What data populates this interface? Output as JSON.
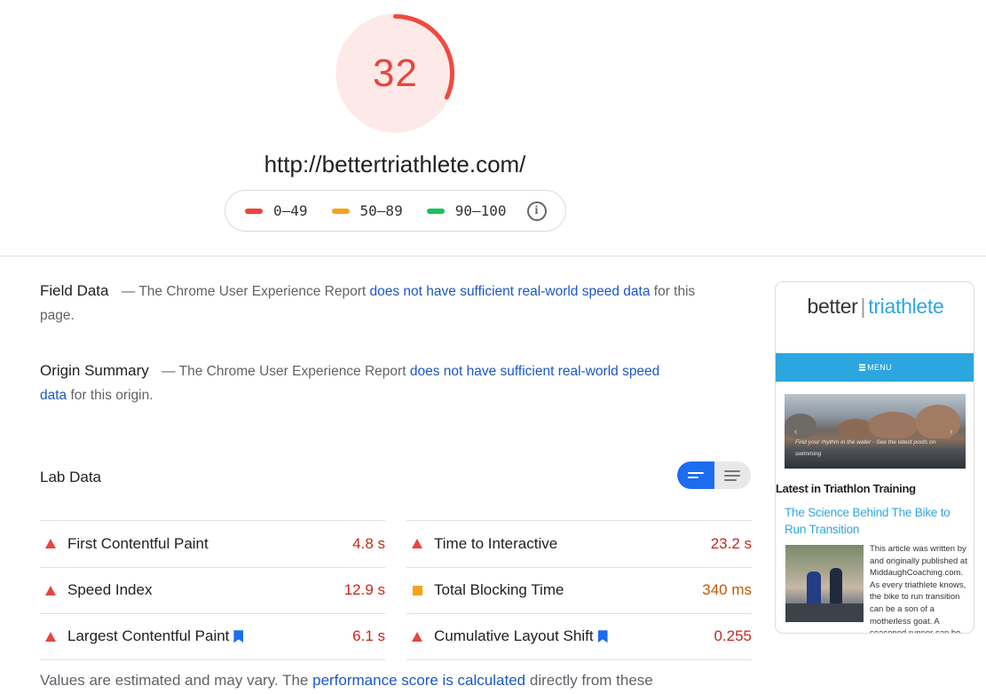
{
  "score": {
    "value": "32",
    "fraction": 0.32,
    "color": "#e8453c"
  },
  "url": "http://bettertriathlete.com/",
  "legend": {
    "items": [
      {
        "label": "0–49",
        "color": "#e8453c"
      },
      {
        "label": "50–89",
        "color": "#f6a21b"
      },
      {
        "label": "90–100",
        "color": "#19c262"
      }
    ],
    "info_icon": "info-icon"
  },
  "field_data": {
    "label": "Field Data",
    "prefix": "— The Chrome User Experience Report",
    "link": "does not have sufficient real-world speed data",
    "suffix": "for this page."
  },
  "origin_summary": {
    "label": "Origin Summary",
    "prefix": "— The Chrome User Experience Report",
    "link": "does not have sufficient real-world speed data",
    "suffix": "for this origin."
  },
  "lab_data": {
    "title": "Lab Data",
    "view_toggle": {
      "selected": "summary-view",
      "other": "detail-view"
    },
    "metrics_left": [
      {
        "name": "First Contentful Paint",
        "value": "4.8 s",
        "status": "fail",
        "icon": "red-triangle-icon",
        "bookmark": false
      },
      {
        "name": "Speed Index",
        "value": "12.9 s",
        "status": "fail",
        "icon": "red-triangle-icon",
        "bookmark": false
      },
      {
        "name": "Largest Contentful Paint",
        "value": "6.1 s",
        "status": "fail",
        "icon": "red-triangle-icon",
        "bookmark": true
      }
    ],
    "metrics_right": [
      {
        "name": "Time to Interactive",
        "value": "23.2 s",
        "status": "fail",
        "icon": "red-triangle-icon",
        "bookmark": false
      },
      {
        "name": "Total Blocking Time",
        "value": "340 ms",
        "status": "average",
        "icon": "orange-square-icon",
        "bookmark": false
      },
      {
        "name": "Cumulative Layout Shift",
        "value": "0.255",
        "status": "fail",
        "icon": "red-triangle-icon",
        "bookmark": true
      }
    ]
  },
  "footnote": {
    "prefix": "Values are estimated and may vary. The",
    "link": "performance score is calculated",
    "suffix": "directly from these"
  },
  "phone": {
    "logo_left": "better",
    "logo_right": "triathlete",
    "menu_label": "MENU",
    "hero_caption": "Find your rhythm in the water - See the latest posts on swimming",
    "section_title": "Latest in Triathlon Training",
    "post_title": "The Science Behind The Bike to Run Transition",
    "excerpt": "This article was written by and originally published at MiddaughCoaching.com. As every triathlete knows, the bike to run transition can be a son of a motherless goat. A seasoned runner can be"
  }
}
